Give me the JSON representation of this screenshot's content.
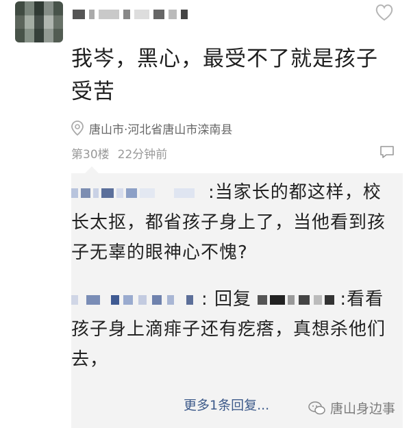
{
  "post": {
    "text": "我岑，黑心，最受不了就是孩子受苦",
    "location": "唐山市·河北省唐山市滦南县",
    "floor": "第30楼",
    "time": "22分钟前"
  },
  "replies": [
    {
      "separator": ":",
      "text": "当家长的都这样，校长太抠，都省孩子身上了，当他看到孩子无辜的眼神心不愧?"
    },
    {
      "reply_prefix": "回复",
      "text": "看看孩子身上滴痱子还有疙瘩，真想杀他们去，"
    }
  ],
  "more_replies": "更多1条回复...",
  "watermark": "唐山身边事",
  "colors": {
    "accent_link": "#3d5a8a",
    "reply_bg": "#f3f3f3"
  }
}
